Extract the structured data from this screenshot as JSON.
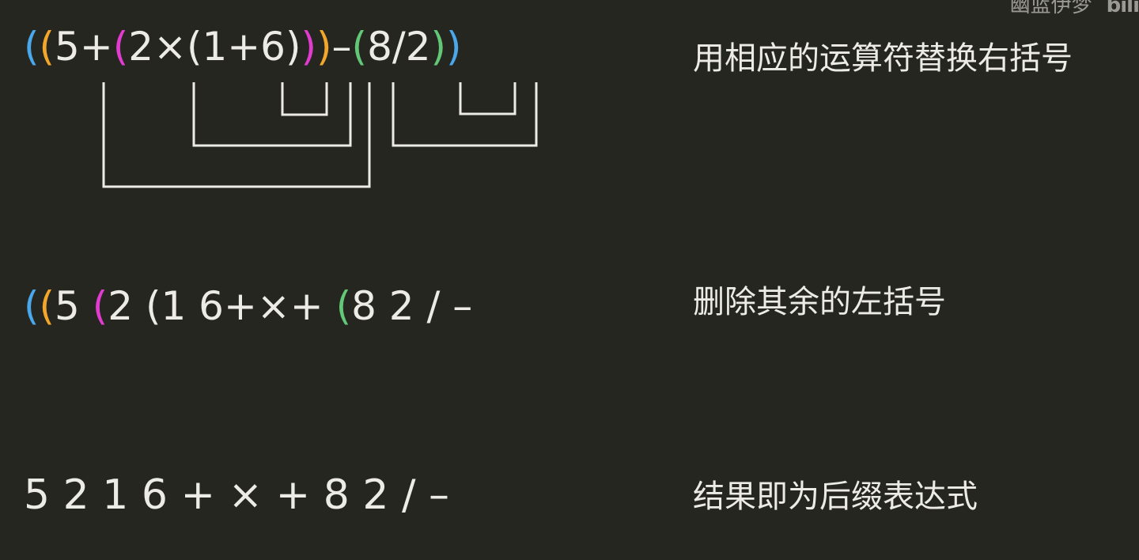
{
  "watermark": {
    "text": "幽蓝伊梦",
    "logo": "bili"
  },
  "colors": {
    "text": "#ecebe6",
    "background": "#262621",
    "blue": "#4aa7ea",
    "orange": "#f2a62c",
    "magenta": "#e13ccf",
    "green": "#62c878"
  },
  "steps": [
    {
      "caption": "用相应的运算符替换右括号",
      "tokens": [
        {
          "t": "(",
          "c": "blue"
        },
        {
          "t": "(",
          "c": "orange"
        },
        {
          "t": "5+",
          "c": "text"
        },
        {
          "t": "(",
          "c": "magenta"
        },
        {
          "t": "2×(1+6)",
          "c": "text"
        },
        {
          "t": ")",
          "c": "magenta"
        },
        {
          "t": ")",
          "c": "orange"
        },
        {
          "t": "–",
          "c": "text"
        },
        {
          "t": "(",
          "c": "green"
        },
        {
          "t": "8/2",
          "c": "text"
        },
        {
          "t": ")",
          "c": "green"
        },
        {
          "t": ")",
          "c": "blue"
        }
      ]
    },
    {
      "caption": "删除其余的左括号",
      "tokens": [
        {
          "t": "(",
          "c": "blue"
        },
        {
          "t": "(",
          "c": "orange"
        },
        {
          "t": "5 ",
          "c": "text"
        },
        {
          "t": "(",
          "c": "magenta"
        },
        {
          "t": "2 (1 6+×+ ",
          "c": "text"
        },
        {
          "t": "(",
          "c": "green"
        },
        {
          "t": "8 2 / –",
          "c": "text"
        }
      ]
    },
    {
      "caption": "结果即为后缀表达式",
      "tokens": [
        {
          "t": "5 2 1 6 + × + 8 2 / –",
          "c": "text"
        }
      ]
    }
  ]
}
